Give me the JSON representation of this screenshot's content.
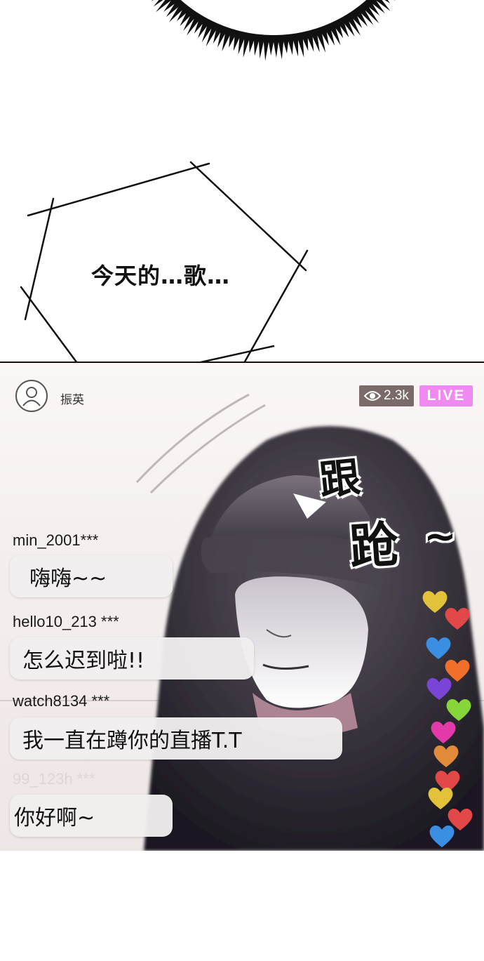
{
  "hex_panel": {
    "text": "今天的…歌…"
  },
  "stream": {
    "streamer_name": "振英",
    "viewer_count": "2.3k",
    "live_label": "LIVE",
    "sfx": {
      "line1": "跟",
      "line2": "跄",
      "tilde": "~"
    },
    "chat": [
      {
        "user": "min_2001***",
        "message": "嗨嗨~~"
      },
      {
        "user": "hello10_213 ***",
        "message": "怎么迟到啦!!"
      },
      {
        "user": "watch8134 ***",
        "message": "我一直在蹲你的直播T.T"
      },
      {
        "user": "99_123h ***",
        "message": "你好啊~"
      }
    ],
    "hearts": [
      {
        "icon": "heart-icon",
        "color": "#e2c23a"
      },
      {
        "icon": "heart-icon",
        "color": "#e34848"
      },
      {
        "icon": "heart-icon",
        "color": "#3a8fe2"
      },
      {
        "icon": "heart-icon",
        "color": "#f0702a"
      },
      {
        "icon": "heart-icon",
        "color": "#7a45d6"
      },
      {
        "icon": "heart-icon",
        "color": "#86d63a"
      },
      {
        "icon": "heart-icon",
        "color": "#e23aa8"
      },
      {
        "icon": "heart-icon",
        "color": "#e08a3a"
      },
      {
        "icon": "heart-icon",
        "color": "#e34848"
      },
      {
        "icon": "heart-icon",
        "color": "#e2c23a"
      },
      {
        "icon": "heart-icon",
        "color": "#e34848"
      },
      {
        "icon": "heart-icon",
        "color": "#3a8fe2"
      }
    ],
    "colors": {
      "live_badge": "#f08af0",
      "viewer_badge": "#7a6a6a"
    }
  }
}
